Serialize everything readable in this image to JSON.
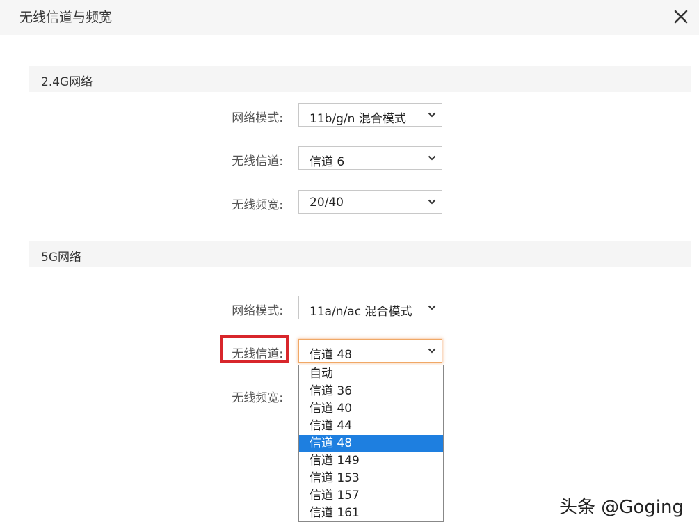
{
  "dialog": {
    "title": "无线信道与频宽",
    "close_icon": "close-icon"
  },
  "network_24g": {
    "section_title": "2.4G网络",
    "mode_label": "网络模式:",
    "mode_value": "11b/g/n 混合模式",
    "channel_label": "无线信道:",
    "channel_value": "信道 6",
    "bandwidth_label": "无线频宽:",
    "bandwidth_value": "20/40"
  },
  "network_5g": {
    "section_title": "5G网络",
    "mode_label": "网络模式:",
    "mode_value": "11a/n/ac 混合模式",
    "channel_label": "无线信道:",
    "channel_value": "信道 48",
    "bandwidth_label": "无线频宽:",
    "channel_options": [
      "自动",
      "信道 36",
      "信道 40",
      "信道 44",
      "信道 48",
      "信道 149",
      "信道 153",
      "信道 157",
      "信道 161"
    ],
    "selected_option": "信道 48"
  },
  "watermark": "头条 @Goging",
  "colors": {
    "header_bg": "#f6f6f6",
    "section_bg": "#f5f5f5",
    "selected_option_bg": "#1e7fe0",
    "highlight_border": "#d8262b",
    "focus_glow": "#f0a866"
  },
  "icons": {
    "dropdown": "chevron-down-icon",
    "close": "close-icon"
  }
}
